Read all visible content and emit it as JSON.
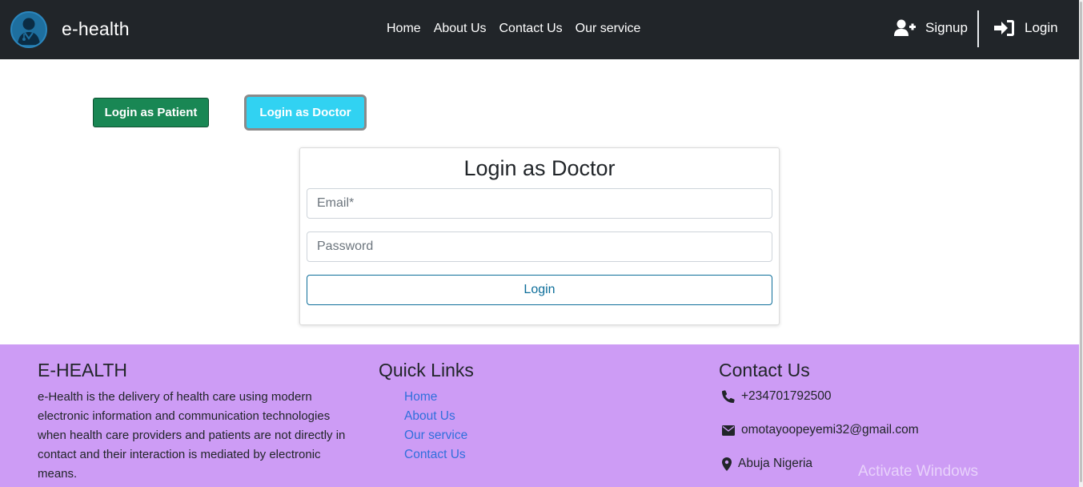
{
  "navbar": {
    "brand": "e-health",
    "links": [
      "Home",
      "About Us",
      "Contact Us",
      "Our service"
    ],
    "signup_label": "Signup",
    "login_label": "Login",
    "logo_icon": "doctor-avatar-icon"
  },
  "role_buttons": {
    "patient_label": "Login as Patient",
    "doctor_label": "Login as Doctor",
    "patient_color": "#198754",
    "doctor_color": "#0dcaf0"
  },
  "login_card": {
    "title": "Login as Doctor",
    "email_placeholder": "Email*",
    "password_placeholder": "Password",
    "submit_label": "Login"
  },
  "footer": {
    "background": "#cd9cf5",
    "about_title": "E-HEALTH",
    "about_text": "e-Health is the delivery of health care using modern electronic information and communication technologies when health care providers and patients are not directly in contact and their interaction is mediated by electronic means.",
    "links_title": "Quick Links",
    "links": [
      "Home",
      "About Us",
      "Our service",
      "Contact Us"
    ],
    "contact_title": "Contact Us",
    "phone": "+234701792500",
    "email": "omotayoopeyemi32@gmail.com",
    "address": "Abuja Nigeria",
    "watermark": "Activate Windows"
  }
}
